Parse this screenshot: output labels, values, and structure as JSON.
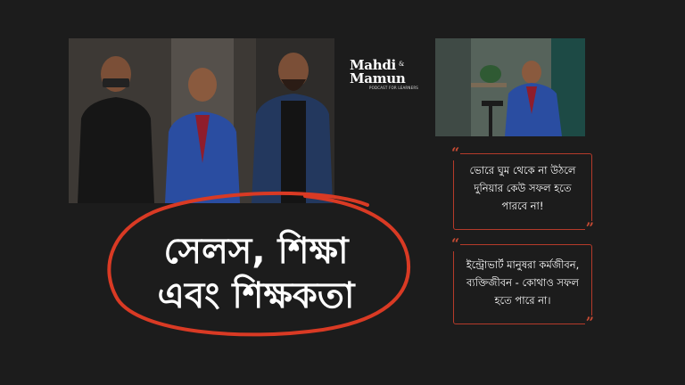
{
  "logo": {
    "line1": "Mahdi",
    "amp": "&",
    "line2": "Mamun",
    "tagline": "PODCAST FOR LEARNERS"
  },
  "title": {
    "line1": "সেলস, শিক্ষা",
    "line2": "এবং শিক্ষকতা"
  },
  "quotes": [
    {
      "text": "ভোরে ঘুম থেকে না উঠলে\nদুনিয়ার কেউ সফল হতে\nপারবে না!"
    },
    {
      "text": "ইন্ট্রোভার্ট মানুষরা কর্মজীবন,\nব্যক্তিজীবন - কোথাও সফল\nহতে পারে না।"
    }
  ],
  "colors": {
    "background": "#1c1c1c",
    "accent": "#c64a33"
  }
}
